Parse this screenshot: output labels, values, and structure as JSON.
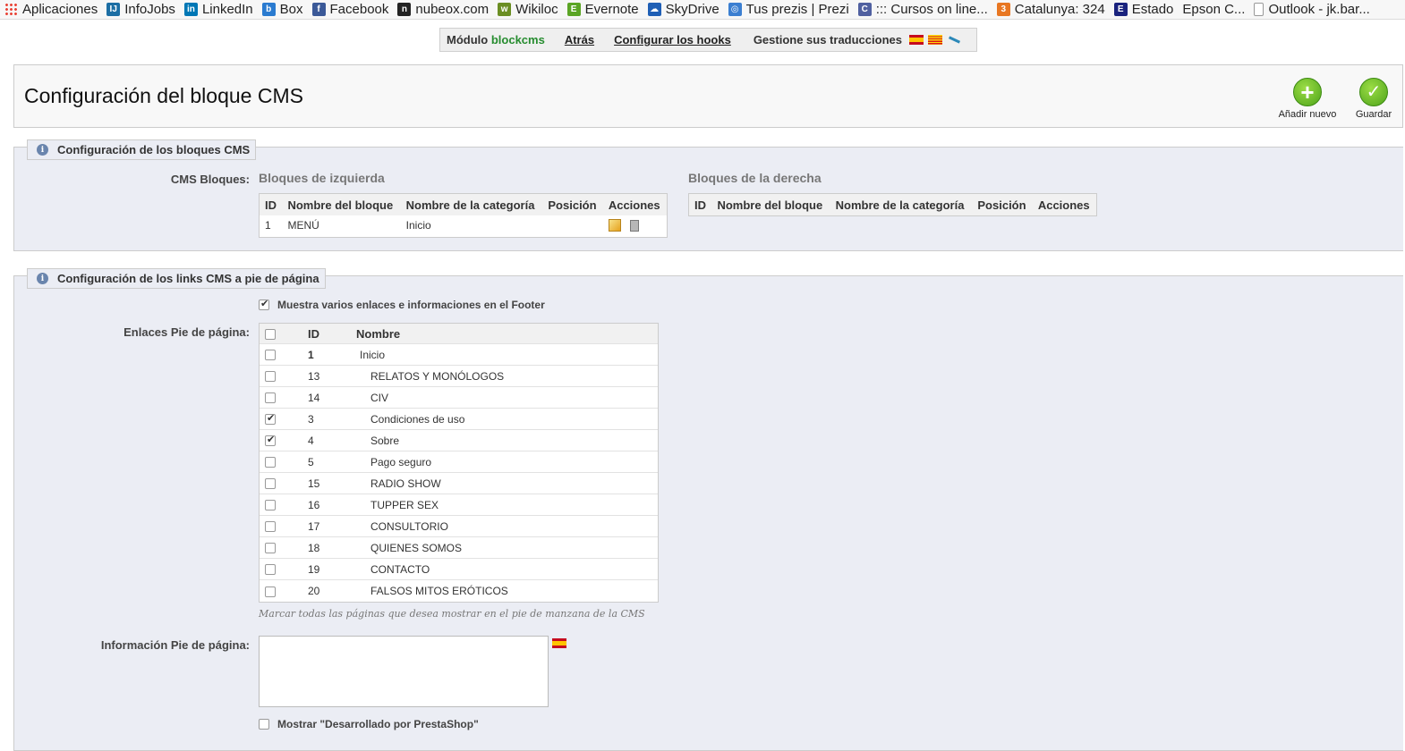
{
  "bookmarks": [
    {
      "label": "Aplicaciones",
      "icon": "apps-grid-icon",
      "color": "#e94235"
    },
    {
      "label": "InfoJobs",
      "icon": "infojobs-icon",
      "color": "#1c6ea4",
      "glyph": "IJ"
    },
    {
      "label": "LinkedIn",
      "icon": "linkedin-icon",
      "color": "#0077b5",
      "glyph": "in"
    },
    {
      "label": "Box",
      "icon": "box-icon",
      "color": "#2a7bd0",
      "glyph": "b"
    },
    {
      "label": "Facebook",
      "icon": "facebook-icon",
      "color": "#3b5998",
      "glyph": "f"
    },
    {
      "label": "nubeox.com",
      "icon": "nubeox-icon",
      "color": "#222222",
      "glyph": "n"
    },
    {
      "label": "Wikiloc",
      "icon": "wikiloc-icon",
      "color": "#6b8e23",
      "glyph": "w"
    },
    {
      "label": "Evernote",
      "icon": "evernote-icon",
      "color": "#5ba525",
      "glyph": "E"
    },
    {
      "label": "SkyDrive",
      "icon": "skydrive-icon",
      "color": "#1f5fb5",
      "glyph": "☁"
    },
    {
      "label": "Tus prezis | Prezi",
      "icon": "prezi-icon",
      "color": "#3b7fd1",
      "glyph": "◎"
    },
    {
      "label": "::: Cursos on line...",
      "icon": "cursos-icon",
      "color": "#5060a0",
      "glyph": "C"
    },
    {
      "label": "Catalunya: 324",
      "icon": "catalunya-icon",
      "color": "#e87722",
      "glyph": "3"
    },
    {
      "label": "Estado",
      "icon": "epson-icon",
      "color": "#1a237e",
      "glyph": "E"
    },
    {
      "label": "Epson C...",
      "icon": "",
      "color": "",
      "glyph": ""
    },
    {
      "label": "Outlook - jk.bar...",
      "icon": "page-icon",
      "color": "#cccccc",
      "glyph": ""
    }
  ],
  "module_bar": {
    "module_prefix": "Módulo",
    "module_name": "blockcms",
    "back": "Atrás",
    "configure_hooks": "Configurar los hooks",
    "translations": "Gestione sus traducciones"
  },
  "header": {
    "title": "Configuración del bloque CMS",
    "add_new": "Añadir nuevo",
    "save": "Guardar"
  },
  "blocks_section": {
    "legend": "Configuración de los bloques CMS",
    "label": "CMS Bloques:",
    "left_title": "Bloques de izquierda",
    "right_title": "Bloques de la derecha",
    "columns": [
      "ID",
      "Nombre del bloque",
      "Nombre de la categoría",
      "Posición",
      "Acciones"
    ],
    "left_rows": [
      {
        "id": "1",
        "name": "MENÚ",
        "category": "Inicio",
        "position": ""
      }
    ]
  },
  "footer_section": {
    "legend": "Configuración de los links CMS a pie de página",
    "show_footer_label": "Muestra varios enlaces e informaciones en el Footer",
    "show_footer_checked": true,
    "links_label": "Enlaces Pie de página:",
    "links_columns": [
      "ID",
      "Nombre"
    ],
    "links": [
      {
        "id": "1",
        "name": "Inicio",
        "checked": false,
        "level": 0
      },
      {
        "id": "13",
        "name": "RELATOS Y MONÓLOGOS",
        "checked": false,
        "level": 1
      },
      {
        "id": "14",
        "name": "CIV",
        "checked": false,
        "level": 1
      },
      {
        "id": "3",
        "name": "Condiciones de uso",
        "checked": true,
        "level": 1
      },
      {
        "id": "4",
        "name": "Sobre",
        "checked": true,
        "level": 1
      },
      {
        "id": "5",
        "name": "Pago seguro",
        "checked": false,
        "level": 1
      },
      {
        "id": "15",
        "name": "RADIO SHOW",
        "checked": false,
        "level": 1
      },
      {
        "id": "16",
        "name": "TUPPER SEX",
        "checked": false,
        "level": 1
      },
      {
        "id": "17",
        "name": "CONSULTORIO",
        "checked": false,
        "level": 1
      },
      {
        "id": "18",
        "name": "QUIENES SOMOS",
        "checked": false,
        "level": 1
      },
      {
        "id": "19",
        "name": "CONTACTO",
        "checked": false,
        "level": 1
      },
      {
        "id": "20",
        "name": "FALSOS MITOS ERÓTICOS",
        "checked": false,
        "level": 1
      }
    ],
    "note": "Marcar todas las páginas que desea mostrar en el pie de manzana de la CMS",
    "info_label": "Información Pie de página:",
    "info_value": "",
    "powered_label": "Mostrar \"Desarrollado por PrestaShop\"",
    "powered_checked": false
  },
  "colors": {
    "accent_green": "#268c2f",
    "panel_bg": "#ebedf4"
  }
}
